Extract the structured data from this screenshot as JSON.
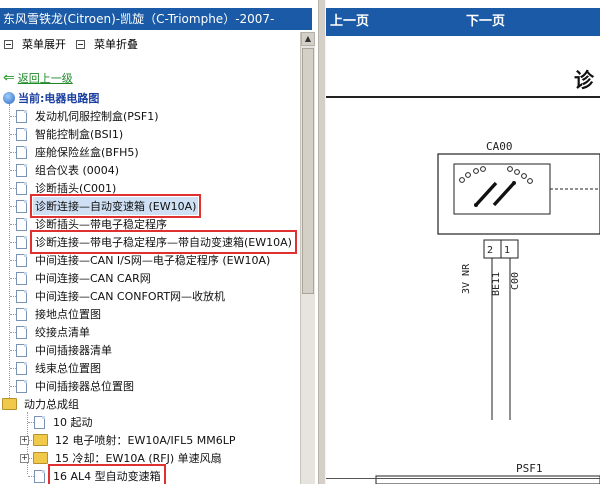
{
  "left_panel": {
    "title": "东风雪铁龙(Citroen)-凯旋（C-Triomphe）-2007-",
    "expand_all": "菜单展开",
    "collapse_all": "菜单折叠",
    "back_link": "返回上一级",
    "current": "当前:电器电路图",
    "items": [
      {
        "label": "发动机伺服控制盒(PSF1)",
        "type": "doc"
      },
      {
        "label": "智能控制盒(BSI1)",
        "type": "doc"
      },
      {
        "label": "座舱保险丝盒(BFH5)",
        "type": "doc"
      },
      {
        "label": "组合仪表 (0004)",
        "type": "doc"
      },
      {
        "label": "诊断插头(C001)",
        "type": "doc"
      },
      {
        "label": "诊断连接—自动变速箱 (EW10A)",
        "type": "doc",
        "highlight": true,
        "selected": true
      },
      {
        "label": "诊断插头—带电子稳定程序",
        "type": "doc"
      },
      {
        "label": "诊断连接—带电子稳定程序—带自动变速箱(EW10A)",
        "type": "doc",
        "highlight": true
      },
      {
        "label": "中间连接—CAN I/S网—电子稳定程序 (EW10A)",
        "type": "doc"
      },
      {
        "label": "中间连接—CAN CAR网",
        "type": "doc"
      },
      {
        "label": "中间连接—CAN CONFORT网—收放机",
        "type": "doc"
      },
      {
        "label": "接地点位置图",
        "type": "doc"
      },
      {
        "label": "绞接点清单",
        "type": "doc"
      },
      {
        "label": "中间插接器清单",
        "type": "doc"
      },
      {
        "label": "线束总位置图",
        "type": "doc"
      },
      {
        "label": "中间插接器总位置图",
        "type": "doc"
      },
      {
        "label": "动力总成组",
        "type": "folder-open"
      },
      {
        "label": "10 起动",
        "type": "doc",
        "indent": 1
      },
      {
        "label": "12 电子喷射：EW10A/IFL5 MM6LP",
        "type": "folder",
        "indent": 1,
        "expand": "+"
      },
      {
        "label": "15 冷却：EW10A (RFJ) 单速风扇",
        "type": "folder",
        "indent": 1,
        "expand": "+"
      },
      {
        "label": "16 AL4 型自动变速箱",
        "type": "doc",
        "indent": 1,
        "highlight": true
      }
    ]
  },
  "right_panel": {
    "prev": "上一页",
    "next": "下一页",
    "heading": "诊",
    "diagram": {
      "connector": "CA00",
      "pins": [
        "2",
        "1"
      ],
      "wire_labels": [
        "3V NR",
        "BE11",
        "C00"
      ],
      "bottom_label": "PSF1"
    }
  }
}
